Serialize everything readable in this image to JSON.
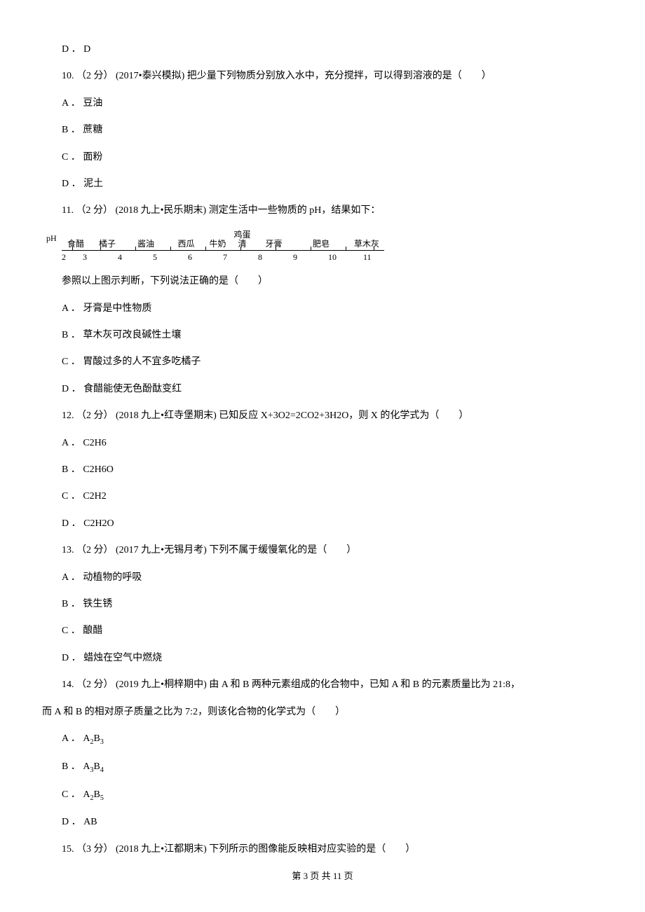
{
  "q9": {
    "optD": "D ． D"
  },
  "q10": {
    "stem": "10. （2 分） (2017•泰兴模拟) 把少量下列物质分别放入水中，充分搅拌，可以得到溶液的是（　　）",
    "a": "A ． 豆油",
    "b": "B ． 蔗糖",
    "c": "C ． 面粉",
    "d": "D ． 泥土"
  },
  "q11": {
    "stem": "11. （2 分） (2018 九上•民乐期末) 测定生活中一些物质的 pH，结果如下：",
    "after": "参照以上图示判断，下列说法正确的是（　　）",
    "a": "A ． 牙膏是中性物质",
    "b": "B ． 草木灰可改良碱性土壤",
    "c": "C ． 胃酸过多的人不宜多吃橘子",
    "d": "D ． 食醋能使无色酚酞变红"
  },
  "chart_data": {
    "type": "table",
    "title": "生活中一些物质的 pH",
    "xlabel": "pH",
    "items": [
      {
        "name": "食醋",
        "ph": 2
      },
      {
        "name": "橘子",
        "ph": 3
      },
      {
        "name": "酱油",
        "ph": 4.5
      },
      {
        "name": "西瓜",
        "ph": 5.5
      },
      {
        "name": "牛奶",
        "ph": 6.5
      },
      {
        "name": "鸡蛋清",
        "ph": 7.5
      },
      {
        "name": "牙膏",
        "ph": 8
      },
      {
        "name": "肥皂",
        "ph": 10
      },
      {
        "name": "草木灰",
        "ph": 11
      }
    ],
    "ticks": [
      2,
      3,
      4,
      5,
      6,
      7,
      8,
      9,
      10,
      11
    ],
    "axis_label": "pH",
    "xlim": [
      2,
      11
    ]
  },
  "q12": {
    "stem": "12. （2 分） (2018 九上•红寺堡期末) 已知反应 X+3O2=2CO2+3H2O，则 X 的化学式为（　　）",
    "a": "A ． C2H6",
    "b": "B ． C2H6O",
    "c": "C ． C2H2",
    "d": "D ． C2H2O"
  },
  "q13": {
    "stem": "13. （2 分） (2017 九上•无锡月考) 下列不属于缓慢氧化的是（　　）",
    "a": "A ． 动植物的呼吸",
    "b": "B ． 铁生锈",
    "c": "C ． 酿醋",
    "d": "D ． 蜡烛在空气中燃烧"
  },
  "q14": {
    "stem1": "14. （2 分） (2019 九上•桐梓期中) 由 A 和 B 两种元素组成的化合物中，已知 A 和 B 的元素质量比为 21:8，",
    "stem2": "而 A 和 B 的相对原子质量之比为 7:2，则该化合物的化学式为（　　）",
    "a_pre": "A ． ",
    "b_pre": "B ． ",
    "c_pre": "C ． ",
    "d_pre": "D ． ",
    "a_f": {
      "base": "A",
      "s1": "2",
      "base2": "B",
      "s2": "3"
    },
    "b_f": {
      "base": "A",
      "s1": "3",
      "base2": "B",
      "s2": "4"
    },
    "c_f": {
      "base": "A",
      "s1": "2",
      "base2": "B",
      "s2": "5"
    },
    "d_f": "AB"
  },
  "q15": {
    "stem": "15. （3 分） (2018 九上•江都期末) 下列所示的图像能反映相对应实验的是（　　）"
  },
  "footer": "第 3 页 共 11 页"
}
